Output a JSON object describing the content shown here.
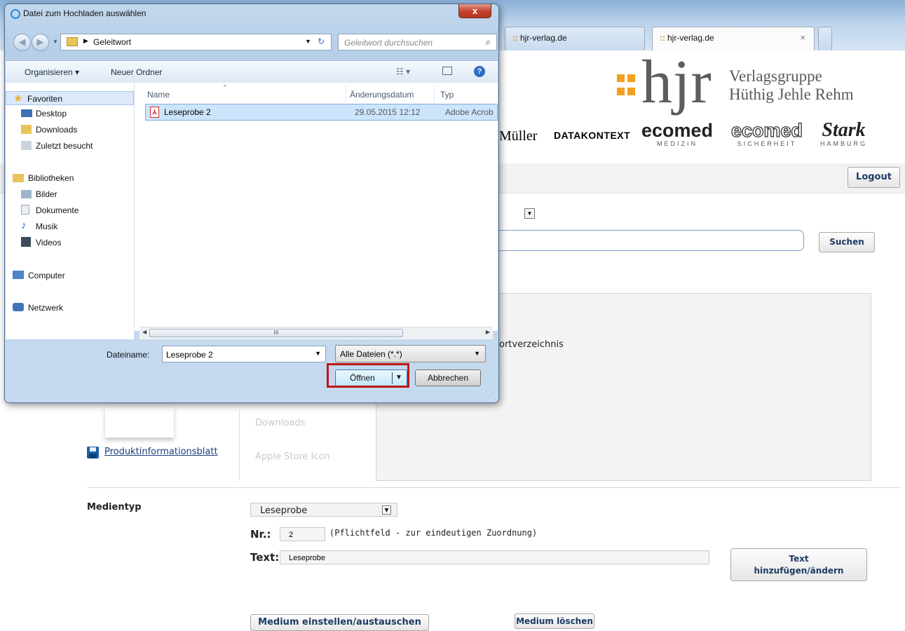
{
  "browser": {
    "tabs": [
      {
        "label": "hjr-verlag.de"
      },
      {
        "label": "hjr-verlag.de",
        "close": "×"
      }
    ]
  },
  "site": {
    "logo_text": "hjr",
    "tagline_line1": "Verlagsgruppe",
    "tagline_line2": "Hüthig Jehle Rehm",
    "brands": {
      "mueller": "Müller",
      "datakontext": "DATAKONTEXT",
      "ecomed1": "ecomed",
      "ecomed1_sub": "MEDIZIN",
      "ecomed2": "ecomed",
      "ecomed2_sub": "SICHERHEIT",
      "stark": "Stark",
      "stark_sub": "HAMBURG"
    },
    "logout_label": "Logout",
    "search_label": "Suchen",
    "panel_text_fragment": "ortverzeichnis",
    "left_list": [
      "Downloads",
      "Apple Store Icon"
    ],
    "product_link": "Produktinformationsblatt",
    "medientyp_label": "Medientyp",
    "medientyp_value": "Leseprobe",
    "nr_label": "Nr.:",
    "nr_value": "2",
    "nr_hint": "(Pflichtfeld - zur eindeutigen Zuordnung)",
    "text_label": "Text:",
    "text_value": "Leseprobe",
    "text_button_line1": "Text",
    "text_button_line2": "hinzufügen/ändern",
    "medium_set_label": "Medium einstellen/austauschen",
    "medium_delete_label": "Medium löschen"
  },
  "dialog": {
    "title": "Datei zum Hochladen auswählen",
    "close_glyph": "x",
    "address": {
      "folder": "Geleitwort"
    },
    "search_placeholder": "Geleitwort durchsuchen",
    "toolbar": {
      "organize": "Organisieren ▾",
      "new_folder": "Neuer Ordner",
      "views": "☷ ▾",
      "help": "?"
    },
    "nav": {
      "favorites": "Favoriten",
      "desktop": "Desktop",
      "downloads": "Downloads",
      "recent": "Zuletzt besucht",
      "libraries": "Bibliotheken",
      "pictures": "Bilder",
      "documents": "Dokumente",
      "music": "Musik",
      "videos": "Videos",
      "computer": "Computer",
      "network": "Netzwerk"
    },
    "columns": {
      "name": "Name",
      "date": "Änderungsdatum",
      "type": "Typ"
    },
    "files": [
      {
        "name": "Leseprobe 2",
        "date": "29.05.2015 12:12",
        "type": "Adobe Acrob"
      }
    ],
    "scroll_thumb": "III",
    "filename_label": "Dateiname:",
    "filename_value": "Leseprobe 2",
    "filter_value": "Alle Dateien (*.*)",
    "open_label": "Öffnen",
    "cancel_label": "Abbrechen"
  }
}
